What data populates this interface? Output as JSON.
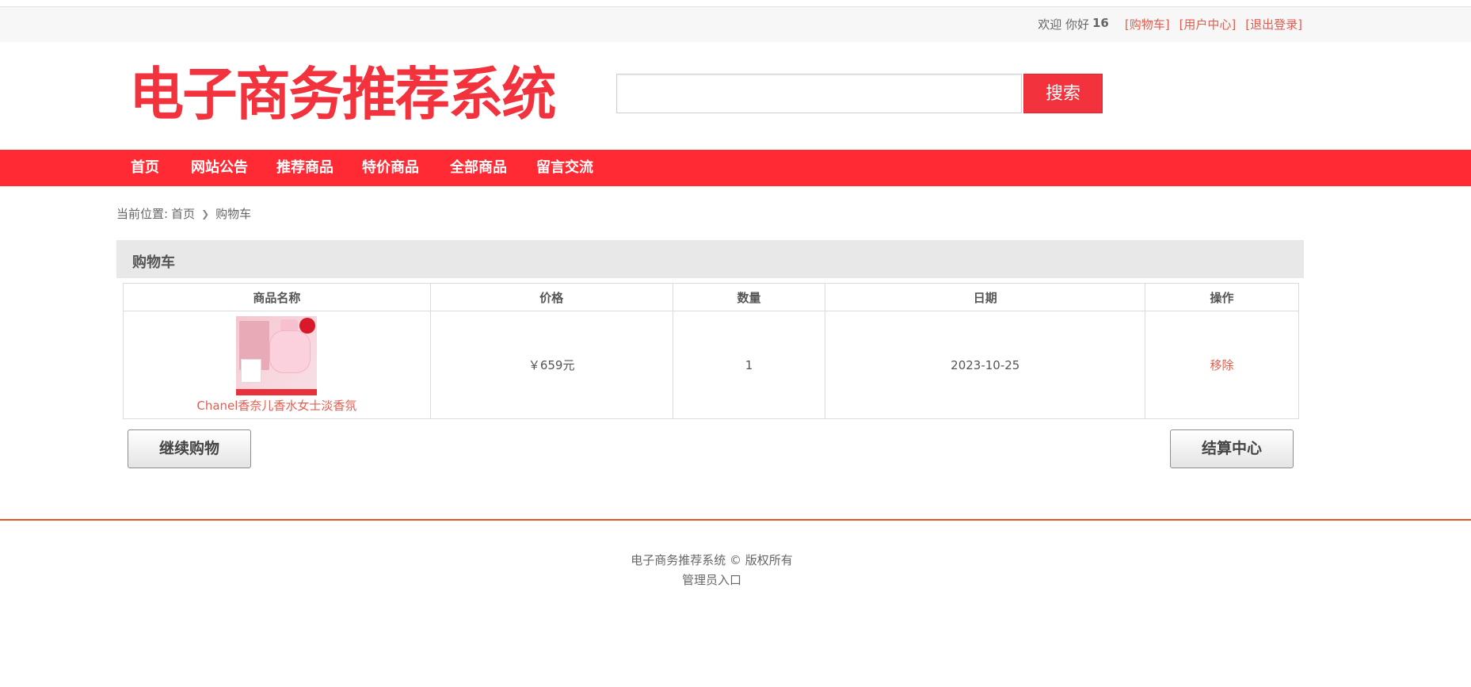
{
  "topbar": {
    "welcome": "欢迎 你好",
    "username": "16",
    "links": [
      "[购物车]",
      "[用户中心]",
      "[退出登录]"
    ]
  },
  "header": {
    "logo_text": "电子商务推荐系统",
    "search_placeholder": "",
    "search_button": "搜索"
  },
  "nav": {
    "items": [
      "首页",
      "网站公告",
      "推荐商品",
      "特价商品",
      "全部商品",
      "留言交流"
    ]
  },
  "breadcrumb": {
    "prefix": "当前位置:",
    "home": "首页",
    "current": "购物车"
  },
  "cart": {
    "title": "购物车",
    "columns": [
      "商品名称",
      "价格",
      "数量",
      "日期",
      "操作"
    ],
    "rows": [
      {
        "name": "Chanel香奈儿香水女士淡香氛",
        "price": "￥659元",
        "quantity": "1",
        "date": "2023-10-25",
        "action": "移除"
      }
    ],
    "continue_button": "继续购物",
    "checkout_button": "结算中心"
  },
  "footer": {
    "copyright": "电子商务推荐系统 © 版权所有",
    "admin_link": "管理员入口"
  },
  "colors": {
    "brand_red": "#ff2a33",
    "link_orange": "#e35d4f",
    "footer_line": "#e3581c"
  }
}
